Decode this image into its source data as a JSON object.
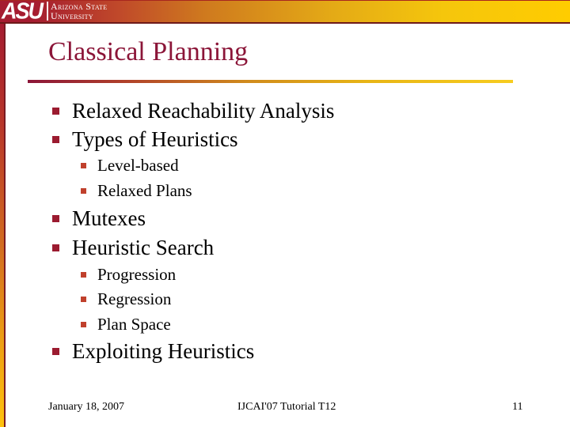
{
  "header": {
    "logo_mark": "ASU",
    "logo_line1": "Arizona State",
    "logo_line2": "University",
    "colors": {
      "maroon": "#a51c30",
      "gold": "#ffcc00"
    }
  },
  "slide": {
    "title": "Classical Planning",
    "bullets": [
      {
        "level": 1,
        "text": "Relaxed Reachability Analysis"
      },
      {
        "level": 1,
        "text": "Types of Heuristics"
      },
      {
        "level": 2,
        "text": "Level-based"
      },
      {
        "level": 2,
        "text": "Relaxed Plans"
      },
      {
        "level": 1,
        "text": "Mutexes"
      },
      {
        "level": 1,
        "text": "Heuristic Search"
      },
      {
        "level": 2,
        "text": "Progression"
      },
      {
        "level": 2,
        "text": "Regression"
      },
      {
        "level": 2,
        "text": "Plan Space"
      },
      {
        "level": 1,
        "text": "Exploiting Heuristics"
      }
    ],
    "bullet_icon": "square-bullet-icon",
    "colors": {
      "title": "#8b1538",
      "bullet_level1": "#9b1b30",
      "bullet_level2": "#c0402c"
    }
  },
  "footer": {
    "date": "January 18, 2007",
    "event": "IJCAI'07 Tutorial T12",
    "page_number": "11"
  }
}
